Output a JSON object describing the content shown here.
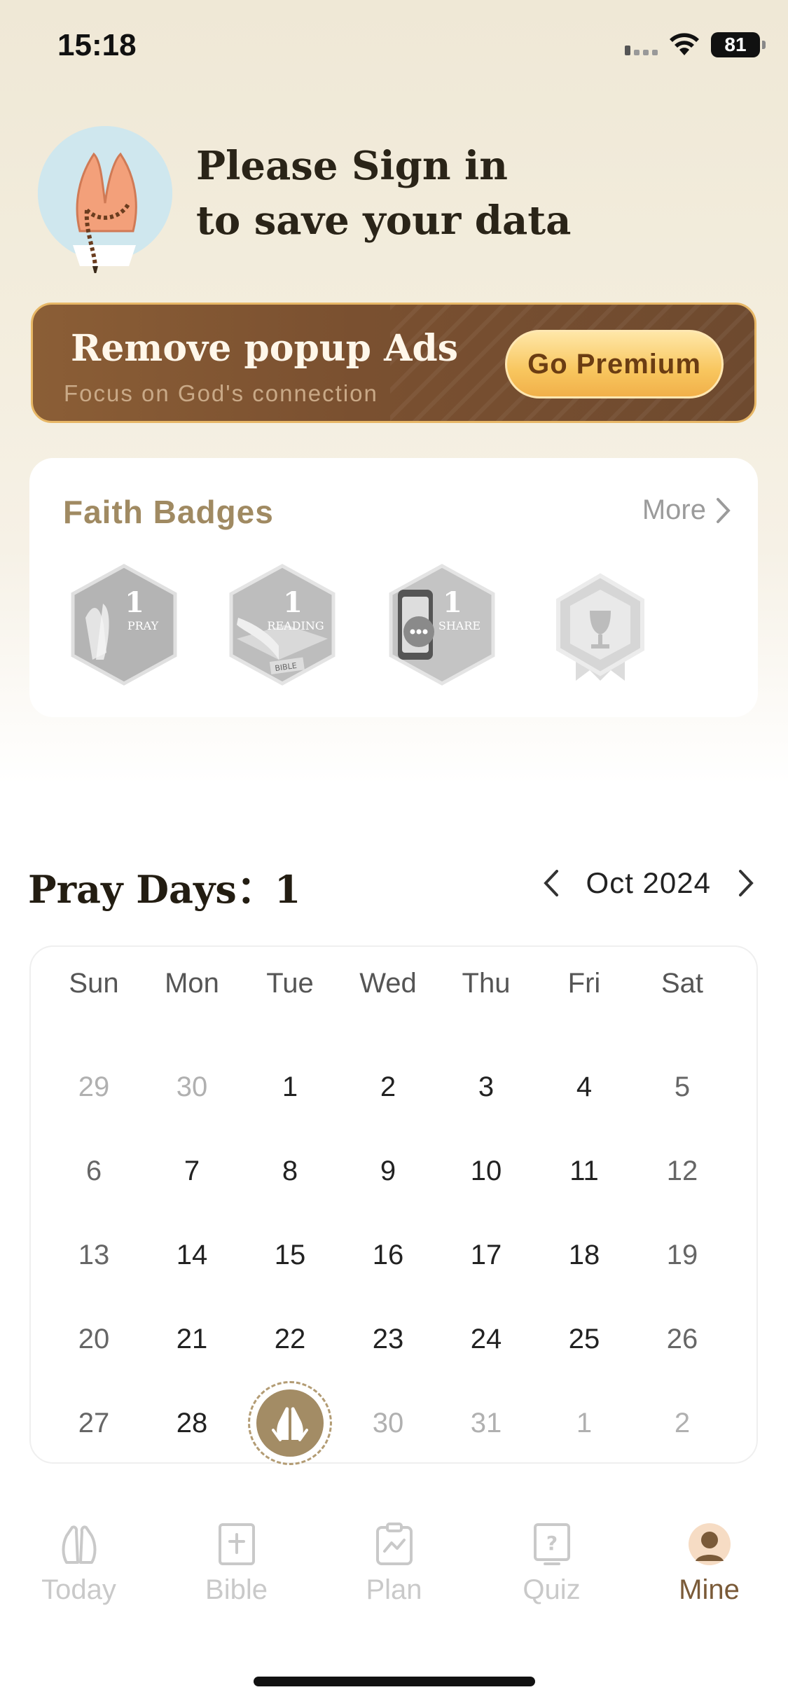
{
  "status": {
    "time": "15:18",
    "battery": "81"
  },
  "profile": {
    "title_line1": "Please Sign in",
    "title_line2": "to save your data"
  },
  "premium": {
    "title": "Remove popup Ads",
    "subtitle": "Focus on God's  connection",
    "button": "Go Premium"
  },
  "badges": {
    "title": "Faith Badges",
    "more": "More",
    "items": [
      {
        "count": "1",
        "label": "PRAY"
      },
      {
        "count": "1",
        "label": "READING"
      },
      {
        "count": "1",
        "label": "SHARE"
      },
      {
        "count": "",
        "label": ""
      }
    ],
    "book_label": "BIBLE"
  },
  "pray": {
    "title": "Pray Days：1",
    "month": "Oct 2024"
  },
  "calendar": {
    "weekdays": [
      "Sun",
      "Mon",
      "Tue",
      "Wed",
      "Thu",
      "Fri",
      "Sat"
    ],
    "weeks": [
      [
        "29",
        "30",
        "1",
        "2",
        "3",
        "4",
        "5"
      ],
      [
        "6",
        "7",
        "8",
        "9",
        "10",
        "11",
        "12"
      ],
      [
        "13",
        "14",
        "15",
        "16",
        "17",
        "18",
        "19"
      ],
      [
        "20",
        "21",
        "22",
        "23",
        "24",
        "25",
        "26"
      ],
      [
        "27",
        "28",
        "",
        "30",
        "31",
        "1",
        "2"
      ]
    ]
  },
  "tabs": [
    {
      "label": "Today",
      "icon": "praying-hands-icon"
    },
    {
      "label": "Bible",
      "icon": "bible-icon"
    },
    {
      "label": "Plan",
      "icon": "plan-icon"
    },
    {
      "label": "Quiz",
      "icon": "quiz-icon"
    },
    {
      "label": "Mine",
      "icon": "profile-icon"
    }
  ],
  "colors": {
    "accent": "#a38c65",
    "premium_bg": "#7a5030",
    "premium_button": "#f8c65e"
  }
}
